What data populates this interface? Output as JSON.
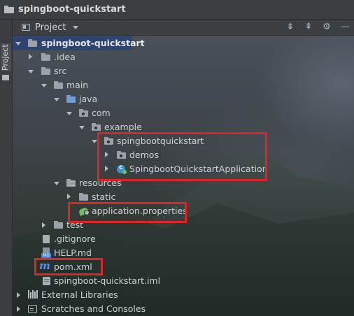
{
  "window": {
    "title": "spingboot-quickstart"
  },
  "tool_strip": {
    "label": "Project"
  },
  "panel": {
    "header_label": "Project"
  },
  "tree": {
    "root": "spingboot-quickstart",
    "idea": ".idea",
    "src": "src",
    "main": "main",
    "java": "java",
    "com": "com",
    "example": "example",
    "pkg": "spingbootquickstart",
    "demos": "demos",
    "app_class": "SpingbootQuickstartApplication",
    "resources": "resources",
    "static": "static",
    "app_props": "application.properties",
    "test": "test",
    "gitignore": ".gitignore",
    "help": "HELP.md",
    "pom": "pom.xml",
    "iml": "spingboot-quickstart.iml",
    "ext_libs": "External Libraries",
    "scratches": "Scratches and Consoles"
  },
  "icons": {
    "folder": "folder-icon",
    "package": "package-icon",
    "class": "java-class-icon",
    "spring": "spring-properties-icon",
    "maven": "maven-icon",
    "markdown": "markdown-icon",
    "libraries": "libraries-icon",
    "scratches": "scratches-icon"
  },
  "colors": {
    "selection": "#2e436e",
    "highlight_box": "#e02424",
    "folder_blue": "#6f9fd6",
    "spring_green": "#6fbf5a",
    "maven_blue": "#5c8de0"
  }
}
